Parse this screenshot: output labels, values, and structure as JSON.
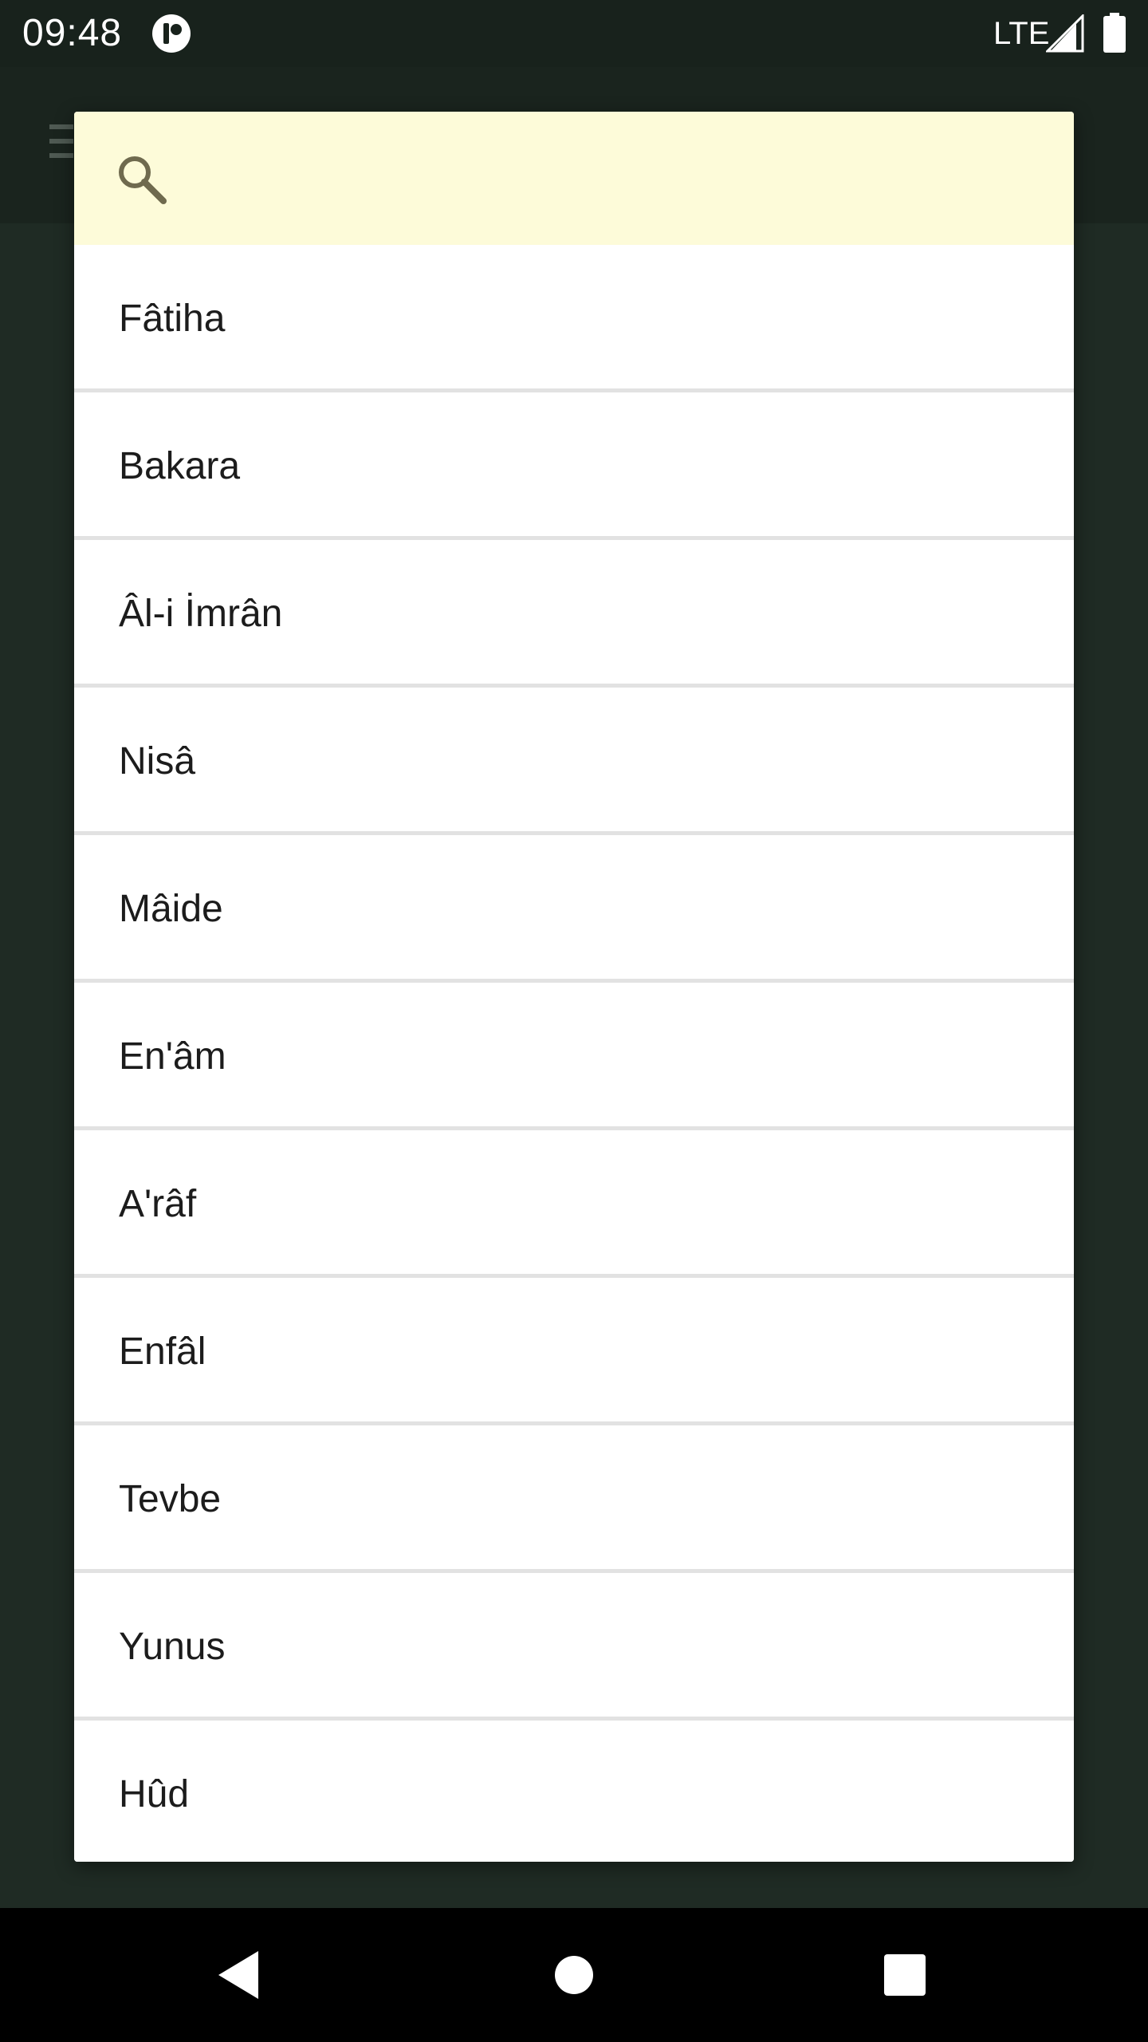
{
  "status_bar": {
    "time": "09:48",
    "network": "LTE",
    "app_icon": "notification-app-icon",
    "signal_icon": "cell-signal-icon",
    "battery_icon": "battery-full-icon"
  },
  "app_bar": {
    "menu_icon": "hamburger-menu-icon"
  },
  "dialog": {
    "search": {
      "icon": "search-icon",
      "value": "",
      "placeholder": "",
      "background_color": "#fdfbd9"
    },
    "items": [
      {
        "label": "Fâtiha"
      },
      {
        "label": "Bakara"
      },
      {
        "label": "Âl-i İmrân"
      },
      {
        "label": "Nisâ"
      },
      {
        "label": "Mâide"
      },
      {
        "label": "En'âm"
      },
      {
        "label": "A'râf"
      },
      {
        "label": "Enfâl"
      },
      {
        "label": "Tevbe"
      },
      {
        "label": "Yunus"
      },
      {
        "label": "Hûd"
      }
    ]
  },
  "nav_bar": {
    "back_icon": "back-triangle-icon",
    "home_icon": "home-circle-icon",
    "recents_icon": "recents-square-icon"
  },
  "colors": {
    "status_bar": "#18221c",
    "app_background": "#1f2b24",
    "dialog_background": "#ffffff",
    "divider": "#e2e2e2",
    "nav_bar": "#000000"
  }
}
